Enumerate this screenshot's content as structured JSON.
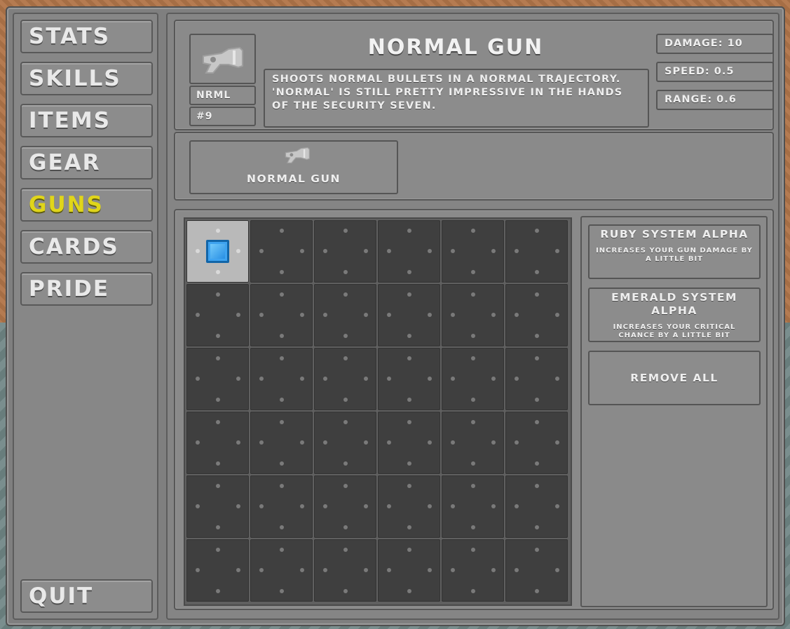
{
  "nav": {
    "items": [
      {
        "label": "STATS"
      },
      {
        "label": "SKILLS"
      },
      {
        "label": "ITEMS"
      },
      {
        "label": "GEAR"
      },
      {
        "label": "GUNS",
        "active": true
      },
      {
        "label": "CARDS"
      },
      {
        "label": "PRIDE"
      }
    ],
    "quit_label": "QUIT"
  },
  "gun": {
    "title": "NORMAL GUN",
    "code": "NRML",
    "number": "#9",
    "description": "SHOOTS NORMAL BULLETS IN A NORMAL TRAJECTORY. 'NORMAL' IS STILL PRETTY IMPRESSIVE IN THE HANDS OF THE SECURITY SEVEN.",
    "icon": "gun-icon",
    "stats": {
      "damage": "DAMAGE: 10",
      "speed": "SPEED: 0.5",
      "range": "RANGE: 0.6"
    }
  },
  "owned_guns": [
    {
      "label": "NORMAL GUN",
      "icon": "gun-icon"
    }
  ],
  "mod_grid": {
    "rows": 6,
    "cols": 6,
    "filled_cells": [
      {
        "row": 0,
        "col": 0,
        "item": "blue-gem"
      }
    ],
    "gem_color": "#2a8fe6"
  },
  "mods": [
    {
      "name": "RUBY SYSTEM ALPHA",
      "description": "INCREASES YOUR GUN DAMAGE BY A LITTLE BIT"
    },
    {
      "name": "EMERALD SYSTEM ALPHA",
      "description": "INCREASES YOUR CRITICAL CHANCE BY A LITTLE BIT"
    }
  ],
  "remove_all_label": "REMOVE ALL",
  "colors": {
    "active_nav": "#e0d51a",
    "panel": "#8a8a8a"
  }
}
